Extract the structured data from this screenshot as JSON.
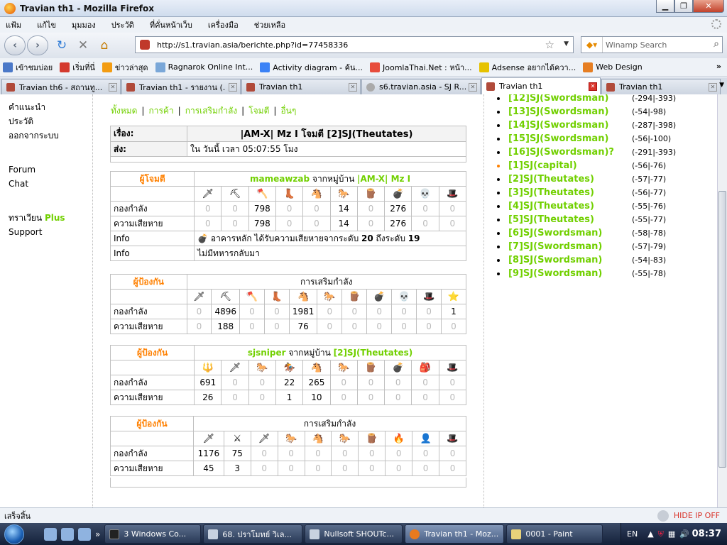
{
  "window": {
    "title": "Travian th1 - Mozilla Firefox"
  },
  "menu": [
    "แฟ้ม",
    "แก้ไข",
    "มุมมอง",
    "ประวัติ",
    "ที่คั่นหน้าเว็บ",
    "เครื่องมือ",
    "ช่วยเหลือ"
  ],
  "nav": {
    "url": "http://s1.travian.asia/berichte.php?id=77458336",
    "search_placeholder": "Winamp Search"
  },
  "bookmarks": [
    "เข้าชมบ่อย",
    "เริ่มที่นี่",
    "ข่าวล่าสุด",
    "Ragnarok Online Int...",
    "Activity diagram - ค้น...",
    "JoomlaThai.Net : หน้า...",
    "Adsense อยากได้ควา...",
    "Web Design"
  ],
  "tabs": [
    "Travian th6 - สถานทู...",
    "Travian th1 - รายงาน (...",
    "Travian th1",
    "s6.travian.asia - SJ R...",
    "Travian th1",
    "Travian th1"
  ],
  "leftnav": {
    "item1": "คำแนะนำ",
    "item2": "ประวัติ",
    "item3": "ออกจากระบบ",
    "forum": "Forum",
    "chat": "Chat",
    "travian": "ทราเวียน ",
    "plus": "Plus",
    "support": "Support"
  },
  "filters": [
    "ทั้งหมด",
    "การค้า",
    "การเสริมกำลัง",
    "โจมตี",
    "อื่นๆ"
  ],
  "report": {
    "subject_label": "เรื่อง:",
    "subject": "|AM-X| Mz I โจมตี [2]SJ(Theutates)",
    "sent_label": "ส่ง:",
    "sent": "ใน วันนี้ เวลา 05:07:55 โมง",
    "troops_label": "กองกำลัง",
    "losses_label": "ความเสียหาย",
    "attacker": {
      "role": "ผู้โจมตี",
      "player": "mameawzab",
      "from": " จากหมู่บ้าน ",
      "village": "|AM-X| Mz I",
      "icons": [
        "🗡",
        "⛏",
        "🪓",
        "👢",
        "🐴",
        "🐎",
        "🪵",
        "💣",
        "💀",
        "🎩"
      ],
      "troops": [
        "0",
        "0",
        "798",
        "0",
        "0",
        "14",
        "0",
        "276",
        "0",
        "0"
      ],
      "losses": [
        "0",
        "0",
        "798",
        "0",
        "0",
        "14",
        "0",
        "276",
        "0",
        "0"
      ],
      "info_label": "Info",
      "info1_prefix": "อาคารหลัก ได้รับความเสียหายจากระดับ ",
      "info1_from": "20",
      "info1_mid": " ถึงระดับ ",
      "info1_to": "19",
      "info2": "ไม่มีทหารกลับมา"
    },
    "defender1": {
      "role": "ผู้ป้องกัน",
      "title": "การเสริมกำลัง",
      "icons": [
        "🗡",
        "⛏",
        "🪓",
        "👢",
        "🐴",
        "🐎",
        "🪵",
        "💣",
        "💀",
        "🎩",
        "⭐"
      ],
      "troops": [
        "0",
        "4896",
        "0",
        "0",
        "1981",
        "0",
        "0",
        "0",
        "0",
        "0",
        "1"
      ],
      "losses": [
        "0",
        "188",
        "0",
        "0",
        "76",
        "0",
        "0",
        "0",
        "0",
        "0",
        "0"
      ]
    },
    "defender2": {
      "role": "ผู้ป้องกัน",
      "player": "sjsniper",
      "from": " จากหมู่บ้าน ",
      "village": "[2]SJ(Theutates)",
      "icons": [
        "🔱",
        "🗡",
        "🐎",
        "🏇",
        "🐴",
        "🐎",
        "🪵",
        "💣",
        "🎒",
        "🎩"
      ],
      "troops": [
        "691",
        "0",
        "0",
        "22",
        "265",
        "0",
        "0",
        "0",
        "0",
        "0"
      ],
      "losses": [
        "26",
        "0",
        "0",
        "1",
        "10",
        "0",
        "0",
        "0",
        "0",
        "0"
      ]
    },
    "defender3": {
      "role": "ผู้ป้องกัน",
      "title": "การเสริมกำลัง",
      "icons": [
        "🗡",
        "⚔",
        "🗡",
        "🐎",
        "🐴",
        "🐎",
        "🪵",
        "🔥",
        "👤",
        "🎩"
      ],
      "troops": [
        "1176",
        "75",
        "0",
        "0",
        "0",
        "0",
        "0",
        "0",
        "0",
        "0"
      ],
      "losses": [
        "45",
        "3",
        "0",
        "0",
        "0",
        "0",
        "0",
        "0",
        "0",
        "0"
      ]
    }
  },
  "villages": [
    {
      "name": "[12]SJ(Swordsman)",
      "coords": "(-294|-393)"
    },
    {
      "name": "[13]SJ(Swordsman)",
      "coords": "(-54|-98)"
    },
    {
      "name": "[14]SJ(Swordsman)",
      "coords": "(-287|-398)"
    },
    {
      "name": "[15]SJ(Swordsman)",
      "coords": "(-56|-100)"
    },
    {
      "name": "[16]SJ(Swordsman)?",
      "coords": "(-291|-393)"
    },
    {
      "name": "[1]SJ(capital)",
      "coords": "(-56|-76)"
    },
    {
      "name": "[2]SJ(Theutates)",
      "coords": "(-57|-77)"
    },
    {
      "name": "[3]SJ(Theutates)",
      "coords": "(-56|-77)"
    },
    {
      "name": "[4]SJ(Theutates)",
      "coords": "(-55|-76)"
    },
    {
      "name": "[5]SJ(Theutates)",
      "coords": "(-55|-77)"
    },
    {
      "name": "[6]SJ(Swordsman)",
      "coords": "(-58|-78)"
    },
    {
      "name": "[7]SJ(Swordsman)",
      "coords": "(-57|-79)"
    },
    {
      "name": "[8]SJ(Swordsman)",
      "coords": "(-54|-83)"
    },
    {
      "name": "[9]SJ(Swordsman)",
      "coords": "(-55|-78)"
    }
  ],
  "status": {
    "text": "เสร็จสิ้น",
    "hide_ip": "HIDE IP OFF"
  },
  "taskbar": {
    "items": [
      "3 Windows Co...",
      "68. ปราโมทย์ วิเล...",
      "Nullsoft SHOUTc...",
      "Travian th1 - Moz...",
      "0001 - Paint"
    ],
    "lang": "EN",
    "time": "08:37"
  }
}
